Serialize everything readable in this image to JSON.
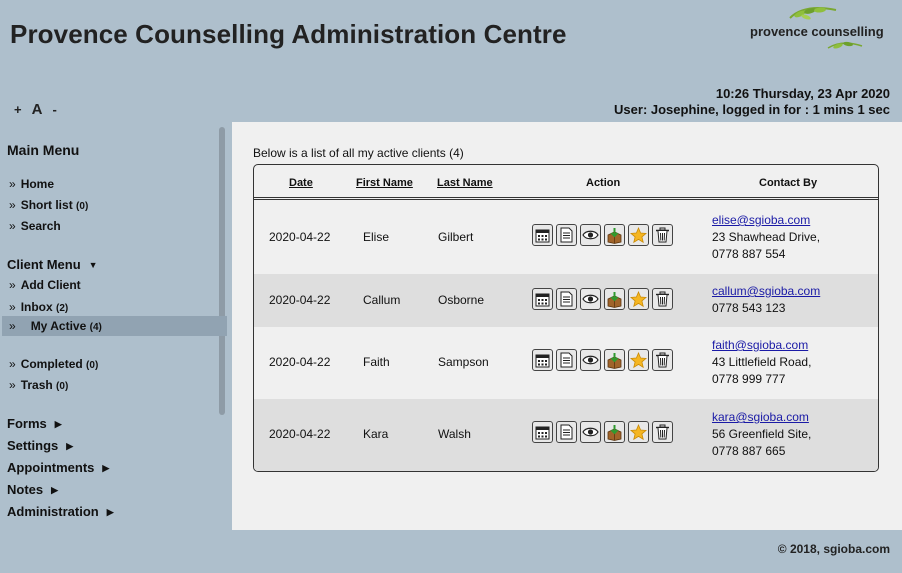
{
  "header": {
    "title": "Provence Counselling Administration Centre",
    "logo_text": "provence counselling",
    "font_controls": {
      "increase": "+",
      "label": "A",
      "decrease": "-"
    },
    "datetime": "10:26 Thursday, 23 Apr 2020",
    "user_status": "User: Josephine, logged in for : 1 mins 1 sec"
  },
  "sidebar": {
    "main_menu_heading": "Main Menu",
    "main_menu": [
      {
        "label": "Home",
        "count": ""
      },
      {
        "label": "Short list",
        "count": "(0)"
      },
      {
        "label": "Search",
        "count": ""
      }
    ],
    "client_menu_heading": "Client Menu",
    "client_menu": [
      {
        "label": "Add Client",
        "count": ""
      },
      {
        "label": "Inbox",
        "count": "(2)"
      },
      {
        "label": "My Active",
        "count": "(4)"
      },
      {
        "label": "Completed",
        "count": "(0)"
      },
      {
        "label": "Trash",
        "count": "(0)"
      }
    ],
    "sections": [
      "Forms",
      "Settings",
      "Appointments",
      "Notes",
      "Administration"
    ]
  },
  "main": {
    "caption": "Below is a list of all my active clients (4)",
    "columns": {
      "date": "Date",
      "first_name": "First Name",
      "last_name": "Last Name",
      "action": "Action",
      "contact": "Contact By"
    },
    "rows": [
      {
        "date": "2020-04-22",
        "first_name": "Elise",
        "last_name": "Gilbert",
        "email": "elise@sgioba.com",
        "address": "23 Shawhead Drive,",
        "phone": "0778 887 554"
      },
      {
        "date": "2020-04-22",
        "first_name": "Callum",
        "last_name": "Osborne",
        "email": "callum@sgioba.com",
        "address": "",
        "phone": "0778 543 123"
      },
      {
        "date": "2020-04-22",
        "first_name": "Faith",
        "last_name": "Sampson",
        "email": "faith@sgioba.com",
        "address": "43 Littlefield Road,",
        "phone": "0778 999 777"
      },
      {
        "date": "2020-04-22",
        "first_name": "Kara",
        "last_name": "Walsh",
        "email": "kara@sgioba.com",
        "address": "56 Greenfield Site,",
        "phone": "0778 887 665"
      }
    ],
    "action_icons": [
      "calendar-icon",
      "document-icon",
      "eye-icon",
      "box-download-icon",
      "star-icon",
      "trash-icon"
    ]
  },
  "footer": {
    "copyright": "© 2018, sgioba.com"
  }
}
